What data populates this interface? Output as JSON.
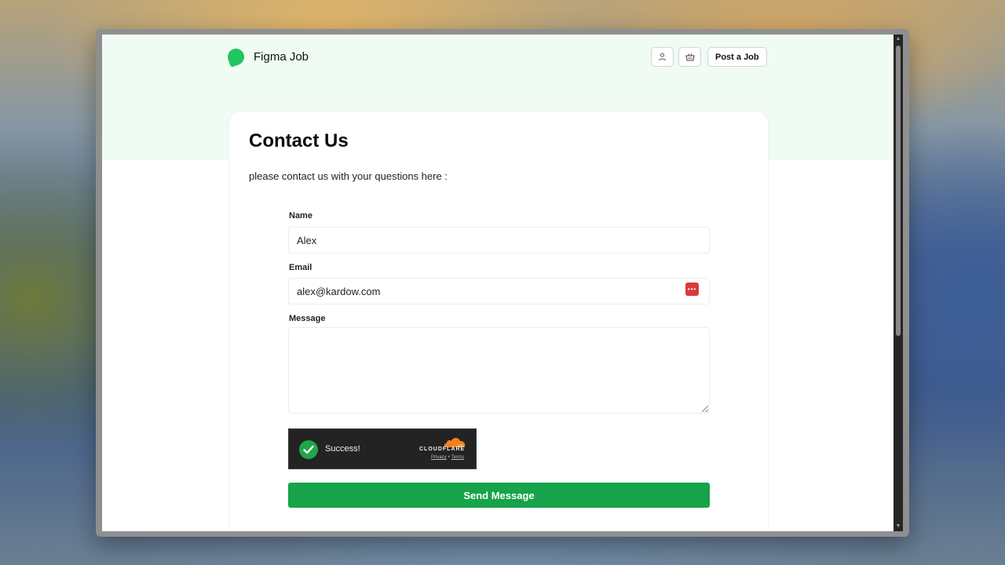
{
  "brand": {
    "name": "Figma Job",
    "accent": "#22c55e"
  },
  "header": {
    "icons": [
      "user-icon",
      "basket-icon"
    ],
    "post_job_label": "Post a Job"
  },
  "page": {
    "title": "Contact Us",
    "subtitle": "please contact us with your questions here :"
  },
  "form": {
    "name_label": "Name",
    "name_value": "Alex",
    "email_label": "Email",
    "email_value": "alex@kardow.com",
    "message_label": "Message",
    "message_value": "",
    "submit_label": "Send Message",
    "submit_color": "#16a34a"
  },
  "captcha": {
    "status": "Success!",
    "provider": "CLOUDFLARE",
    "privacy_label": "Privacy",
    "separator": "•",
    "terms_label": "Terms",
    "status_color": "#22a64a"
  },
  "colors": {
    "hero_background": "#effbf3",
    "captcha_background": "#232323",
    "password_manager_icon": "#d63b3b"
  }
}
